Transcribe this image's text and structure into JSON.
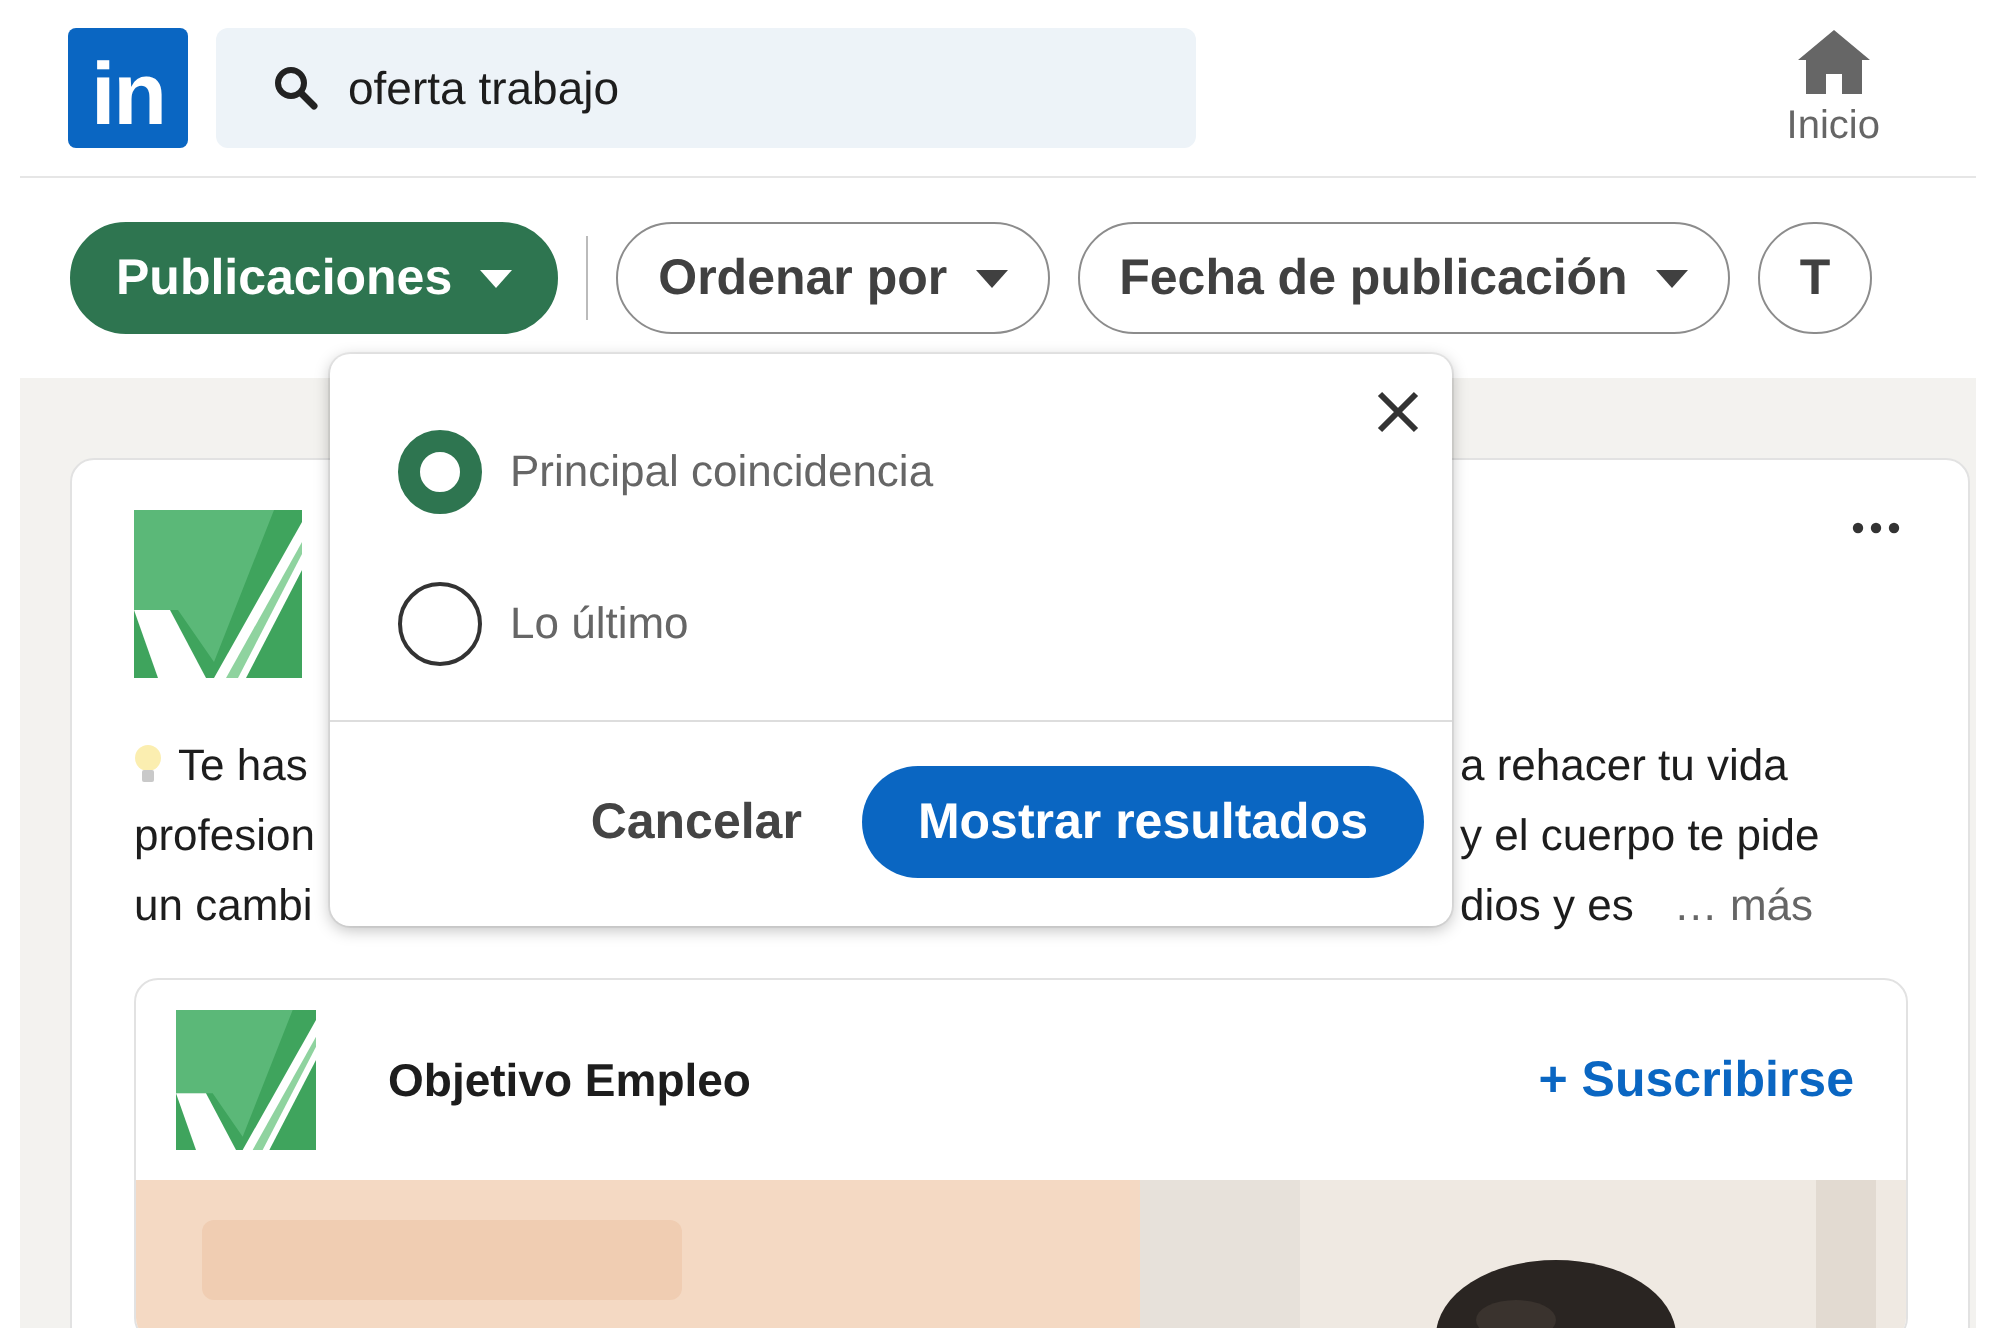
{
  "header": {
    "logo": "in",
    "search": {
      "value": "oferta trabajo"
    },
    "nav": [
      {
        "label": "Inicio",
        "selected": false
      }
    ]
  },
  "filters": [
    {
      "label": "Publicaciones",
      "selected": true,
      "has_caret": true
    },
    {
      "label": "Ordenar por",
      "selected": false,
      "has_caret": true
    },
    {
      "label": "Fecha de publicación",
      "selected": false,
      "has_caret": true
    },
    {
      "label": "T",
      "selected": false,
      "has_caret": false
    }
  ],
  "post": {
    "lines": [
      {
        "left": "Te has",
        "right": "a rehacer tu vida",
        "lead_icon": true
      },
      {
        "left": "profesion",
        "right": "y el cuerpo te pide",
        "lead_icon": false
      },
      {
        "left": "un cambi",
        "right": "dios y es",
        "lead_icon": false
      }
    ],
    "more": "… más",
    "embed": {
      "name": "Objetivo Empleo",
      "action": "+ Suscribirse"
    }
  },
  "sort_menu": {
    "options": [
      {
        "label": "Principal coincidencia",
        "selected": true
      },
      {
        "label": "Lo último",
        "selected": false
      }
    ],
    "buttons": [
      {
        "label": "Cancelar",
        "kind": "secondary"
      },
      {
        "label": "Mostrar resultados",
        "kind": "primary"
      }
    ]
  }
}
